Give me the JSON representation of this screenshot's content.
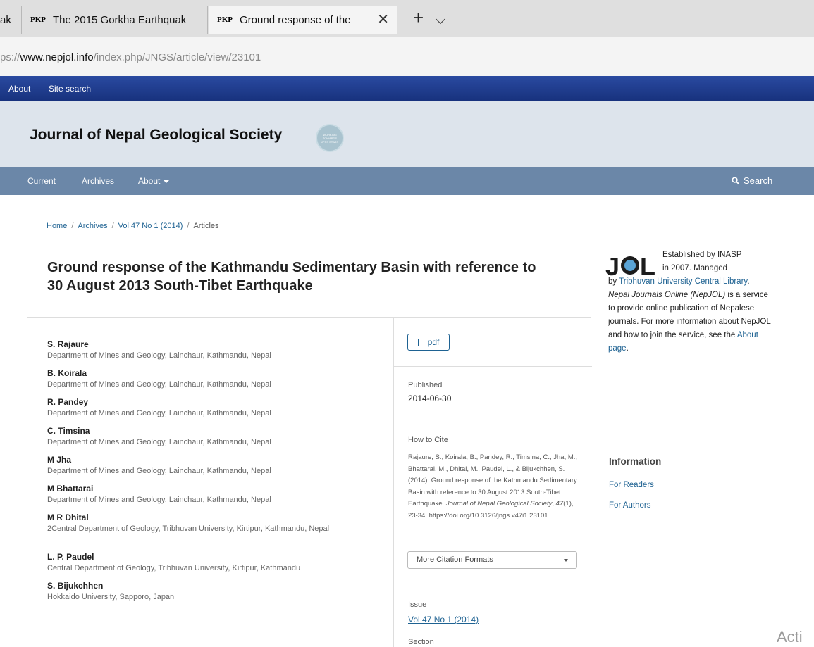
{
  "browser": {
    "tabs": [
      {
        "favicon": "",
        "title": "ak",
        "active": false
      },
      {
        "favicon": "PKP",
        "title": "The 2015 Gorkha Earthquak",
        "active": false
      },
      {
        "favicon": "PKP",
        "title": "Ground response of the",
        "active": true
      }
    ],
    "new_tab": "+",
    "url_prefix": "ps://",
    "url_domain": "www.nepjol.info",
    "url_path": "/index.php/JNGS/article/view/23101"
  },
  "topbar": {
    "links": [
      "About",
      "Site search"
    ]
  },
  "header": {
    "site_title": "Journal of Nepal Geological Society",
    "seal_text": "WORKING TOWARDS JPPS STARS"
  },
  "nav": {
    "items": [
      "Current",
      "Archives",
      "About"
    ],
    "search_label": "Search"
  },
  "breadcrumb": {
    "items": [
      "Home",
      "Archives",
      "Vol 47 No 1 (2014)",
      "Articles"
    ],
    "separator": "/"
  },
  "article": {
    "title": "Ground response of the Kathmandu Sedimentary Basin with reference to 30 August 2013 South-Tibet Earthquake",
    "authors": [
      {
        "name": "S. Rajaure",
        "affiliation": "Department of Mines and Geology, Lainchaur, Kathmandu, Nepal"
      },
      {
        "name": "B. Koirala",
        "affiliation": "Department of Mines and Geology, Lainchaur, Kathmandu, Nepal"
      },
      {
        "name": "R. Pandey",
        "affiliation": "Department of Mines and Geology, Lainchaur, Kathmandu, Nepal"
      },
      {
        "name": "C. Timsina",
        "affiliation": "Department of Mines and Geology, Lainchaur, Kathmandu, Nepal"
      },
      {
        "name": "M Jha",
        "affiliation": "Department of Mines and Geology, Lainchaur, Kathmandu, Nepal"
      },
      {
        "name": "M Bhattarai",
        "affiliation": "Department of Mines and Geology, Lainchaur, Kathmandu, Nepal"
      },
      {
        "name": "M R Dhital",
        "affiliation": "2Central Department of Geology, Tribhuvan University, Kirtipur, Kathmandu, Nepal"
      },
      {
        "name": "L. P. Paudel",
        "affiliation": "Central Department of Geology, Tribhuvan University, Kirtipur, Kathmandu"
      },
      {
        "name": "S. Bijukchhen",
        "affiliation": "Hokkaido University, Sapporo, Japan"
      }
    ],
    "pdf_label": "pdf",
    "published_label": "Published",
    "published_date": "2014-06-30",
    "how_to_cite_label": "How to Cite",
    "citation": {
      "authors_year": "Rajaure, S., Koirala, B., Pandey, R., Timsina, C., Jha, M., Bhattarai, M., Dhital, M., Paudel, L., & Bijukchhen, S. (2014). Ground response of the Kathmandu Sedimentary Basin with reference to 30 August 2013 South-Tibet Earthquake.",
      "journal": "Journal of Nepal Geological Society",
      "volume": "47",
      "issue_pages": "(1), 23-34. https://doi.org/10.3126/jngs.v47i1.23101"
    },
    "more_citation_formats": "More Citation Formats",
    "issue_label": "Issue",
    "issue_value": "Vol 47 No 1 (2014)",
    "section_label": "Section"
  },
  "sidebar": {
    "jol_logo": "JOL",
    "jol_line1": "Established by INASP",
    "jol_line2": "in 2007. Managed",
    "jol_by": "by",
    "jol_library": "Tribhuvan University Central Library",
    "jol_desc_italic": "Nepal Journals Online (NepJOL)",
    "jol_desc": "is a service to provide online publication of Nepalese journals. For more information about NepJOL and how to join the service, see the",
    "jol_about_link": "About page",
    "info_heading": "Information",
    "info_links": [
      "For Readers",
      "For Authors"
    ]
  },
  "watermark": "Acti"
}
